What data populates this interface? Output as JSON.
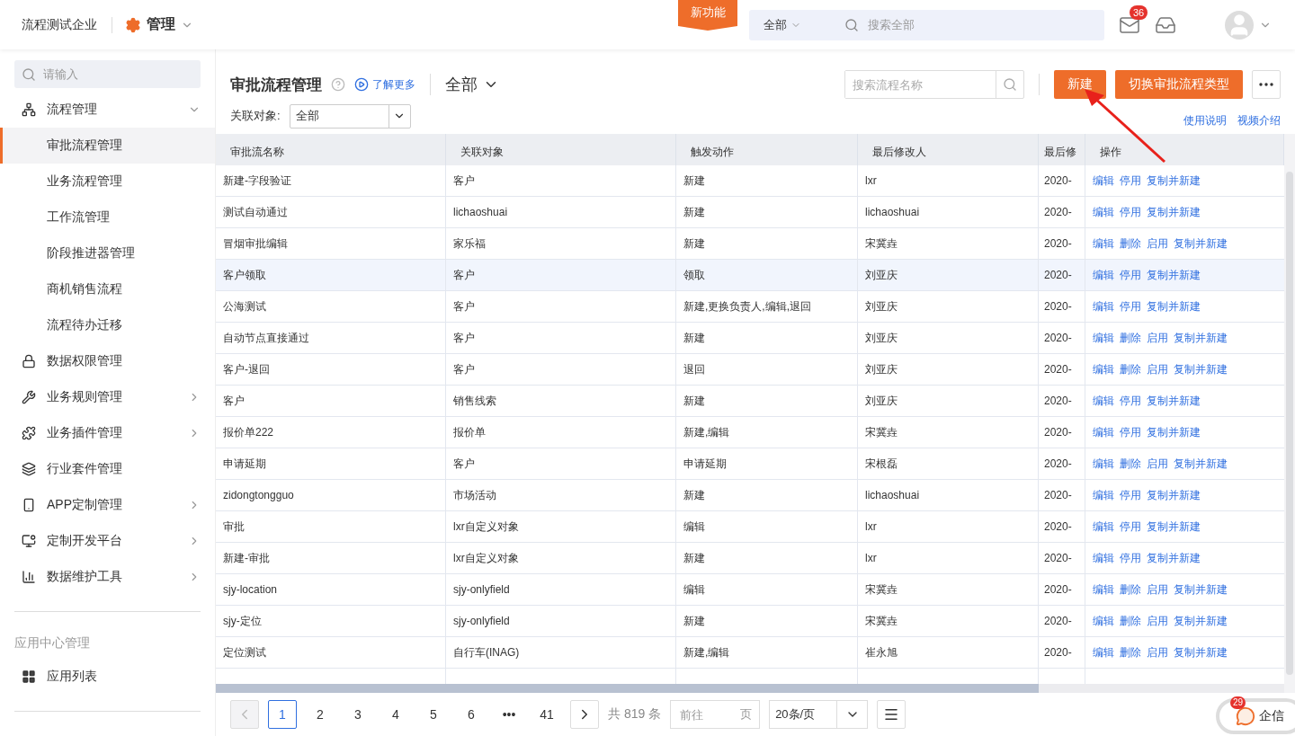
{
  "header": {
    "company": "流程测试企业",
    "module": "管理",
    "new_feature": "新功能",
    "search_scope": "全部",
    "search_placeholder": "搜索全部",
    "mail_badge": "36"
  },
  "sidebar": {
    "search_placeholder": "请输入",
    "items": [
      {
        "label": "流程管理",
        "expandable": true,
        "expanded": true,
        "selected": false,
        "children": [
          {
            "label": "审批流程管理",
            "selected": true
          },
          {
            "label": "业务流程管理",
            "selected": false
          },
          {
            "label": "工作流管理",
            "selected": false
          },
          {
            "label": "阶段推进器管理",
            "selected": false
          },
          {
            "label": "商机销售流程",
            "selected": false
          },
          {
            "label": "流程待办迁移",
            "selected": false
          }
        ]
      },
      {
        "label": "数据权限管理",
        "expandable": false,
        "selected": false
      },
      {
        "label": "业务规则管理",
        "expandable": true,
        "expanded": false,
        "selected": false
      },
      {
        "label": "业务插件管理",
        "expandable": true,
        "expanded": false,
        "selected": false
      },
      {
        "label": "行业套件管理",
        "expandable": false,
        "selected": false
      },
      {
        "label": "APP定制管理",
        "expandable": true,
        "expanded": false,
        "selected": false
      },
      {
        "label": "定制开发平台",
        "expandable": true,
        "expanded": false,
        "selected": false
      },
      {
        "label": "数据维护工具",
        "expandable": true,
        "expanded": false,
        "selected": false
      }
    ],
    "section": {
      "title": "应用中心管理",
      "items": [
        {
          "label": "应用列表",
          "selected": false
        }
      ]
    }
  },
  "toolbar": {
    "title": "审批流程管理",
    "learn_more": "了解更多",
    "scope": "全部",
    "search_placeholder": "搜索流程名称",
    "buttons": [
      "新建",
      "切换审批流程类型"
    ],
    "filter_label": "关联对象:",
    "filter_value": "全部",
    "links": [
      "使用说明",
      "视频介绍"
    ]
  },
  "table": {
    "columns": [
      "审批流名称",
      "关联对象",
      "触发动作",
      "最后修改人",
      "最后修",
      "操作"
    ],
    "rows": [
      {
        "cells": [
          "新建-字段验证",
          "客户",
          "新建",
          "lxr",
          "2020-"
        ],
        "actions": [
          "编辑",
          "停用",
          "复制并新建"
        ],
        "selected": false
      },
      {
        "cells": [
          "测试自动通过",
          "lichaoshuai",
          "新建",
          "lichaoshuai",
          "2020-"
        ],
        "actions": [
          "编辑",
          "停用",
          "复制并新建"
        ],
        "selected": false
      },
      {
        "cells": [
          "冒烟审批编辑",
          "家乐福",
          "新建",
          "宋冀垚",
          "2020-"
        ],
        "actions": [
          "编辑",
          "删除",
          "启用",
          "复制并新建"
        ],
        "selected": false
      },
      {
        "cells": [
          "客户领取",
          "客户",
          "领取",
          "刘亚庆",
          "2020-"
        ],
        "actions": [
          "编辑",
          "停用",
          "复制并新建"
        ],
        "selected": true
      },
      {
        "cells": [
          "公海测试",
          "客户",
          "新建,更换负责人,编辑,退回",
          "刘亚庆",
          "2020-"
        ],
        "actions": [
          "编辑",
          "停用",
          "复制并新建"
        ],
        "selected": false
      },
      {
        "cells": [
          "自动节点直接通过",
          "客户",
          "新建",
          "刘亚庆",
          "2020-"
        ],
        "actions": [
          "编辑",
          "删除",
          "启用",
          "复制并新建"
        ],
        "selected": false
      },
      {
        "cells": [
          "客户-退回",
          "客户",
          "退回",
          "刘亚庆",
          "2020-"
        ],
        "actions": [
          "编辑",
          "删除",
          "启用",
          "复制并新建"
        ],
        "selected": false
      },
      {
        "cells": [
          "客户",
          "销售线索",
          "新建",
          "刘亚庆",
          "2020-"
        ],
        "actions": [
          "编辑",
          "停用",
          "复制并新建"
        ],
        "selected": false
      },
      {
        "cells": [
          "报价单222",
          "报价单",
          "新建,编辑",
          "宋冀垚",
          "2020-"
        ],
        "actions": [
          "编辑",
          "停用",
          "复制并新建"
        ],
        "selected": false
      },
      {
        "cells": [
          "申请延期",
          "客户",
          "申请延期",
          "宋根磊",
          "2020-"
        ],
        "actions": [
          "编辑",
          "删除",
          "启用",
          "复制并新建"
        ],
        "selected": false
      },
      {
        "cells": [
          "zidongtongguo",
          "市场活动",
          "新建",
          "lichaoshuai",
          "2020-"
        ],
        "actions": [
          "编辑",
          "停用",
          "复制并新建"
        ],
        "selected": false
      },
      {
        "cells": [
          "审批",
          "lxr自定义对象",
          "编辑",
          "lxr",
          "2020-"
        ],
        "actions": [
          "编辑",
          "停用",
          "复制并新建"
        ],
        "selected": false
      },
      {
        "cells": [
          "新建-审批",
          "lxr自定义对象",
          "新建",
          "lxr",
          "2020-"
        ],
        "actions": [
          "编辑",
          "停用",
          "复制并新建"
        ],
        "selected": false
      },
      {
        "cells": [
          "sjy-location",
          "sjy-onlyfield",
          "编辑",
          "宋冀垚",
          "2020-"
        ],
        "actions": [
          "编辑",
          "删除",
          "启用",
          "复制并新建"
        ],
        "selected": false
      },
      {
        "cells": [
          "sjy-定位",
          "sjy-onlyfield",
          "新建",
          "宋冀垚",
          "2020-"
        ],
        "actions": [
          "编辑",
          "删除",
          "启用",
          "复制并新建"
        ],
        "selected": false
      },
      {
        "cells": [
          "定位测试",
          "自行车(INAG)",
          "新建,编辑",
          "崔永旭",
          "2020-"
        ],
        "actions": [
          "编辑",
          "删除",
          "启用",
          "复制并新建"
        ],
        "selected": false
      }
    ]
  },
  "pagination": {
    "pages": [
      {
        "label": "1",
        "selected": true
      },
      {
        "label": "2",
        "selected": false
      },
      {
        "label": "3",
        "selected": false
      },
      {
        "label": "4",
        "selected": false
      },
      {
        "label": "5",
        "selected": false
      },
      {
        "label": "6",
        "selected": false
      },
      {
        "label": "•••",
        "selected": false
      },
      {
        "label": "41",
        "selected": false
      }
    ],
    "prev_disabled": true,
    "total": "共 819 条",
    "goto_placeholder": "前往",
    "goto_unit": "页",
    "page_size": "20条/页"
  },
  "chat": {
    "badge": "29",
    "label": "企信"
  }
}
